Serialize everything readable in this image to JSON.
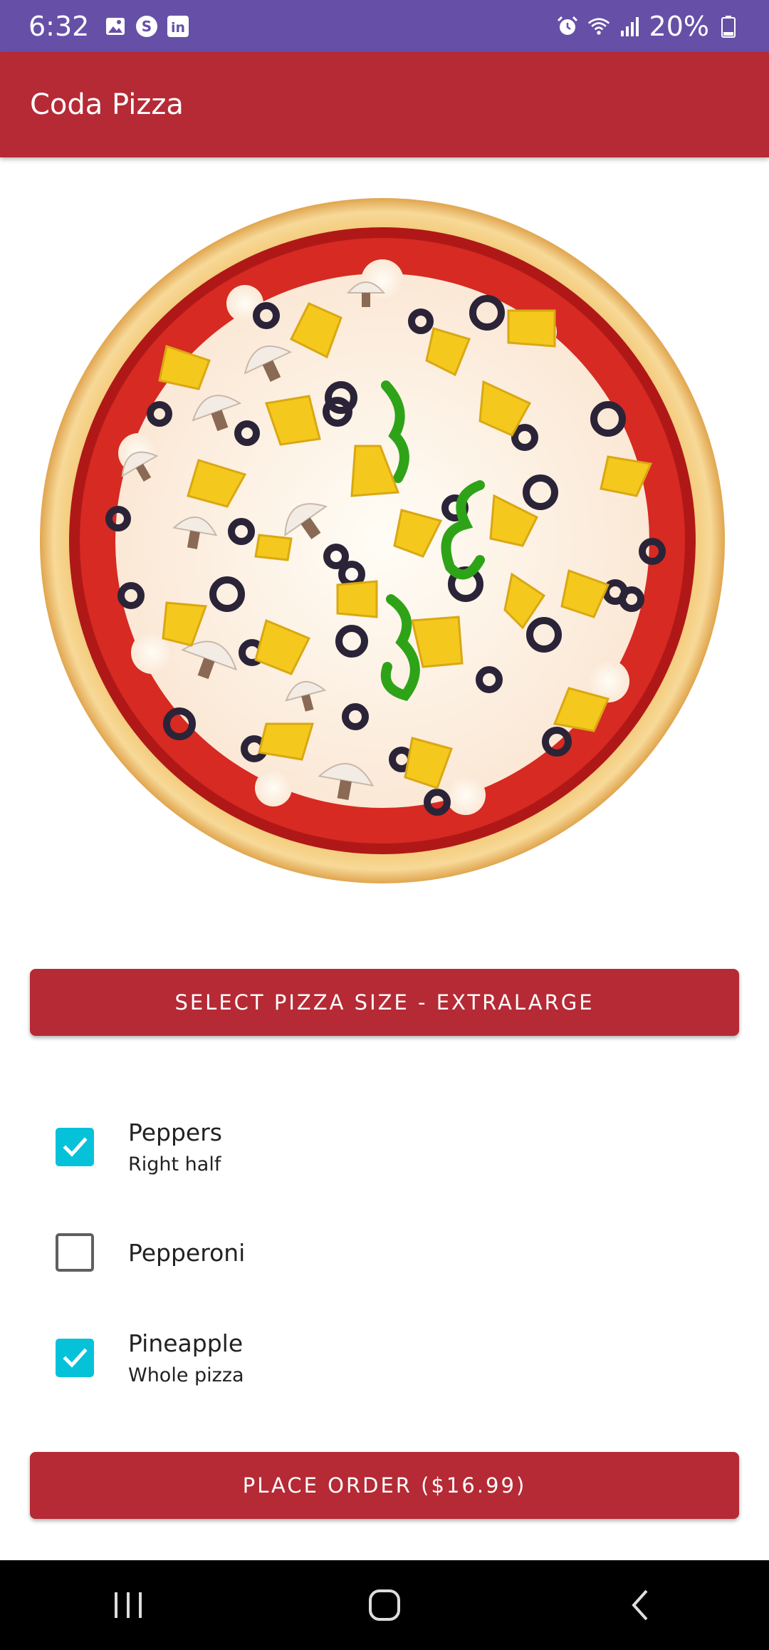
{
  "status_bar": {
    "time": "6:32",
    "battery": "20%",
    "left_icons": [
      "image-icon",
      "sync-icon",
      "linkedin-icon"
    ],
    "right_icons": [
      "alarm-icon",
      "wifi-icon",
      "signal-icon",
      "battery-icon"
    ]
  },
  "app_bar": {
    "title": "Coda Pizza"
  },
  "pizza_image": {
    "description_icon": "pizza-icon"
  },
  "size_button": {
    "label": "SELECT PIZZA SIZE - EXTRALARGE"
  },
  "toppings": [
    {
      "name": "Peppers",
      "placement": "Right half",
      "checked": true
    },
    {
      "name": "Pepperoni",
      "placement": "",
      "checked": false
    },
    {
      "name": "Pineapple",
      "placement": "Whole pizza",
      "checked": true
    }
  ],
  "order_button": {
    "label": "PLACE ORDER ($16.99)"
  },
  "nav_bar": {
    "buttons": [
      "recents-icon",
      "home-icon",
      "back-icon"
    ]
  },
  "colors": {
    "status_bar": "#6650a7",
    "primary": "#b52a35",
    "checkbox_accent": "#06c2d8"
  }
}
